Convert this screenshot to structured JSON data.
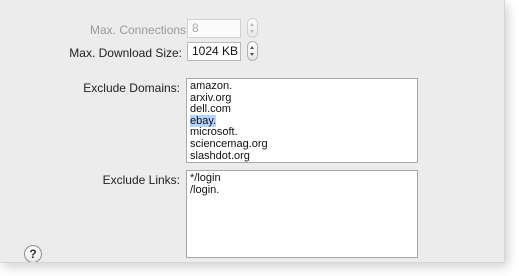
{
  "max_connections": {
    "label": "Max. Connections:",
    "value": "8"
  },
  "max_download_size": {
    "label": "Max. Download Size:",
    "value": "1024 KB"
  },
  "exclude_domains": {
    "label": "Exclude Domains:",
    "items": [
      "amazon.",
      "arxiv.org",
      "dell.com",
      "ebay.",
      "microsoft.",
      "sciencemag.org",
      "slashdot.org"
    ],
    "selected": "ebay."
  },
  "exclude_links": {
    "label": "Exclude Links:",
    "items": [
      "*/login",
      "/login."
    ]
  },
  "help_button": {
    "glyph": "?"
  },
  "colors": {
    "selection": "#b5d5ff",
    "background": "#ececec"
  }
}
